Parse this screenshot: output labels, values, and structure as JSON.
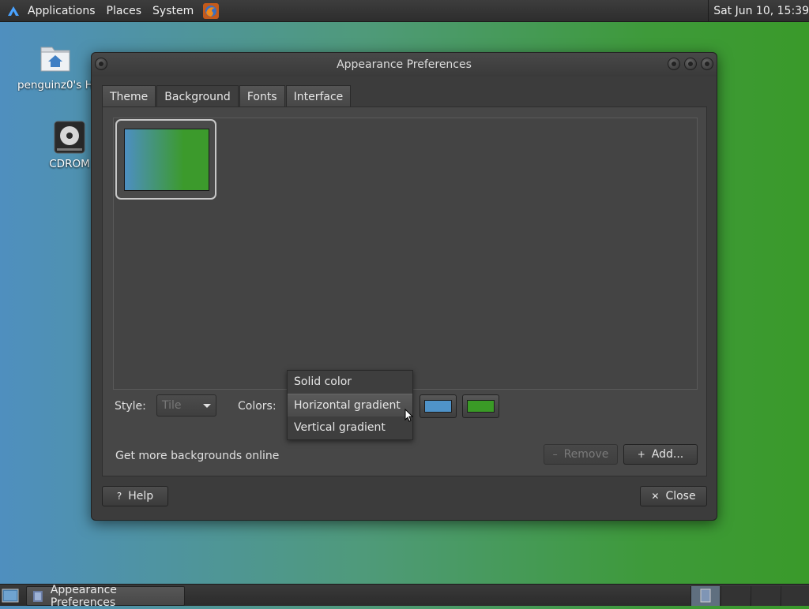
{
  "top_panel": {
    "menus": [
      "Applications",
      "Places",
      "System"
    ],
    "clock": "Sat Jun 10, 15:39"
  },
  "desktop": {
    "icons": [
      {
        "label": "penguinz0's H",
        "icon": "home-folder-icon"
      },
      {
        "label": "CDROM",
        "icon": "cdrom-icon"
      }
    ]
  },
  "dialog": {
    "title": "Appearance Preferences",
    "tabs": [
      {
        "label": "Theme"
      },
      {
        "label": "Background",
        "active": true
      },
      {
        "label": "Fonts"
      },
      {
        "label": "Interface"
      }
    ],
    "background": {
      "thumbnail_colors": [
        "#4d8fc2",
        "#3c9a2c"
      ],
      "style_label": "Style:",
      "style_value": "Tile",
      "colors_label": "Colors:",
      "color_mode_options": [
        "Solid color",
        "Horizontal gradient",
        "Vertical gradient"
      ],
      "color_mode_selected": "Horizontal gradient",
      "primary_color": "#4f93c9",
      "secondary_color": "#3a9a26",
      "more_online_label": "Get more backgrounds online",
      "remove_label": "Remove",
      "add_label": "Add..."
    },
    "help_label": "Help",
    "close_label": "Close"
  },
  "bottom_panel": {
    "task_label": "Appearance Preferences"
  }
}
